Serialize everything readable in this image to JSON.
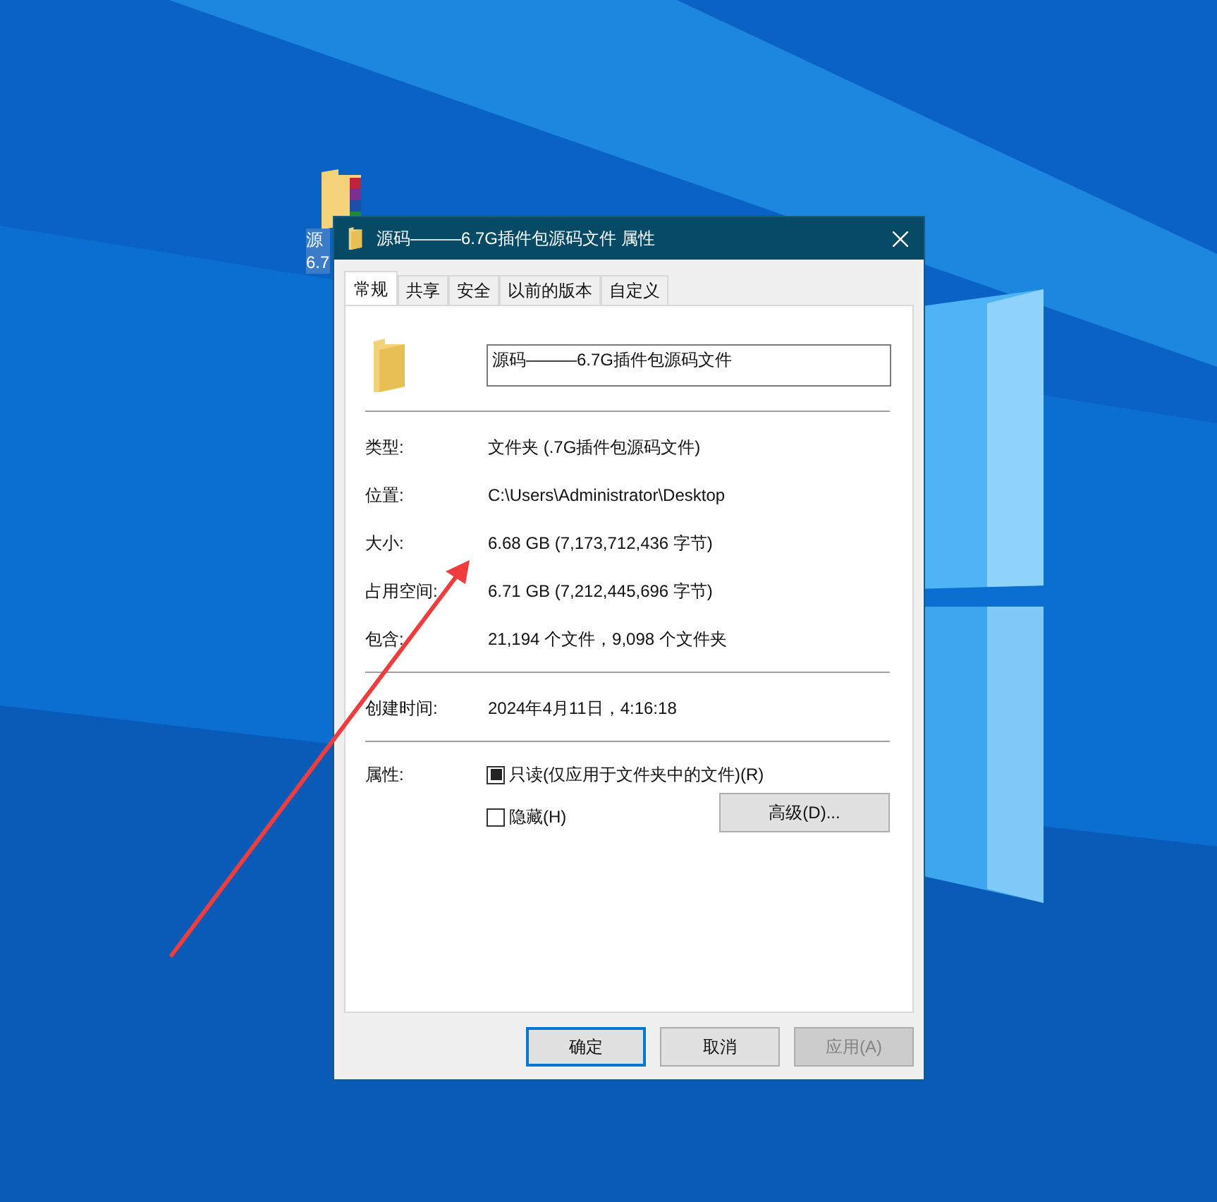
{
  "desktop_icon": {
    "label_lines": [
      "源",
      "6.7"
    ]
  },
  "window": {
    "title": "源码———6.7G插件包源码文件 属性"
  },
  "tabs": [
    {
      "label": "常规",
      "selected": true
    },
    {
      "label": "共享",
      "selected": false
    },
    {
      "label": "安全",
      "selected": false
    },
    {
      "label": "以前的版本",
      "selected": false
    },
    {
      "label": "自定义",
      "selected": false
    }
  ],
  "name_field": {
    "value": "源码———6.7G插件包源码文件"
  },
  "sections": [
    [
      {
        "label": "类型:",
        "value": "文件夹 (.7G插件包源码文件)"
      },
      {
        "label": "位置:",
        "value": "C:\\Users\\Administrator\\Desktop"
      },
      {
        "label": "大小:",
        "value": "6.68 GB (7,173,712,436 字节)"
      },
      {
        "label": "占用空间:",
        "value": "6.71 GB (7,212,445,696 字节)"
      },
      {
        "label": "包含:",
        "value": "21,194 个文件，9,098 个文件夹"
      }
    ],
    [
      {
        "label": "创建时间:",
        "value": "2024年4月11日，4:16:18"
      }
    ]
  ],
  "attributes": {
    "label": "属性:",
    "options": [
      {
        "label": "只读(仅应用于文件夹中的文件)(R)",
        "checked": true
      },
      {
        "label": "隐藏(H)",
        "checked": false
      }
    ],
    "advanced_button": "高级(D)..."
  },
  "buttons": [
    {
      "label": "确定",
      "kind": "default",
      "disabled": false
    },
    {
      "label": "取消",
      "kind": "normal",
      "disabled": false
    },
    {
      "label": "应用(A)",
      "kind": "normal",
      "disabled": true
    }
  ]
}
